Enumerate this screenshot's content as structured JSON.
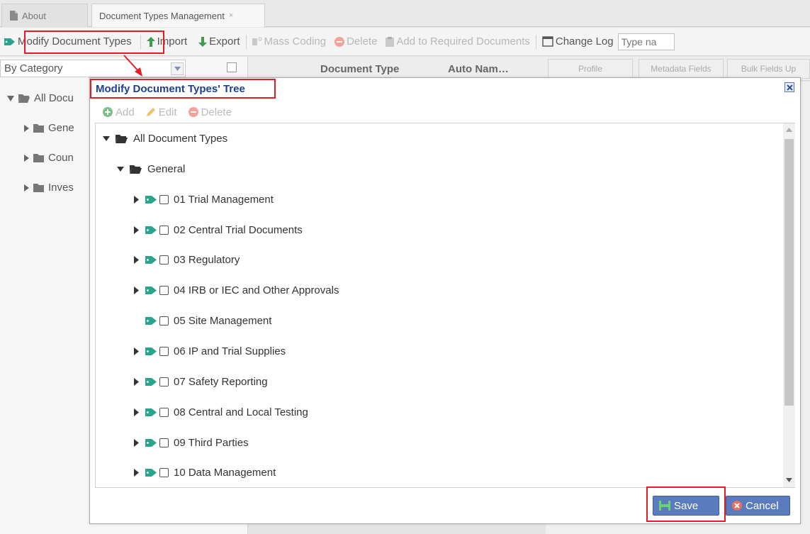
{
  "tabs": [
    {
      "label": "About",
      "icon": "file-icon"
    },
    {
      "label": "Document Types Management",
      "close": "×"
    }
  ],
  "toolbar": {
    "modify": "Modify Document Types",
    "import": "Import",
    "export": "Export",
    "mass_coding": "Mass Coding",
    "delete": "Delete",
    "add_required": "Add to Required Documents",
    "change_log": "Change Log",
    "type_placeholder": "Type na"
  },
  "left_panel": {
    "category": "By Category",
    "tree": [
      "All Docu",
      "Gene",
      "Coun",
      "Inves"
    ]
  },
  "grid": {
    "col_document_type": "Document Type",
    "col_auto_name": "Auto Nam…",
    "btn_profile": "Profile",
    "btn_metadata": "Metadata Fields",
    "btn_bulk": "Bulk Fields Up"
  },
  "dialog": {
    "title": "Modify Document Types' Tree",
    "add": "Add",
    "edit": "Edit",
    "delete": "Delete",
    "root": "All Document Types",
    "group": "General",
    "items": [
      {
        "label": "01 Trial Management",
        "expandable": true
      },
      {
        "label": "02 Central Trial Documents",
        "expandable": true
      },
      {
        "label": "03 Regulatory",
        "expandable": true
      },
      {
        "label": "04 IRB or IEC and Other Approvals",
        "expandable": true
      },
      {
        "label": "05 Site Management",
        "expandable": false
      },
      {
        "label": "06 IP and Trial Supplies",
        "expandable": true
      },
      {
        "label": "07 Safety Reporting",
        "expandable": true
      },
      {
        "label": "08 Central and Local Testing",
        "expandable": true
      },
      {
        "label": "09 Third Parties",
        "expandable": true
      },
      {
        "label": "10 Data Management",
        "expandable": true
      }
    ],
    "save": "Save",
    "cancel": "Cancel"
  },
  "colors": {
    "highlight": "#e31e24",
    "tag": "#2aa58d",
    "title": "#1e3f8f",
    "button": "#5b7bbf",
    "toolbar_green": "#3f9b4e",
    "disabled": "#bbbbbb"
  }
}
